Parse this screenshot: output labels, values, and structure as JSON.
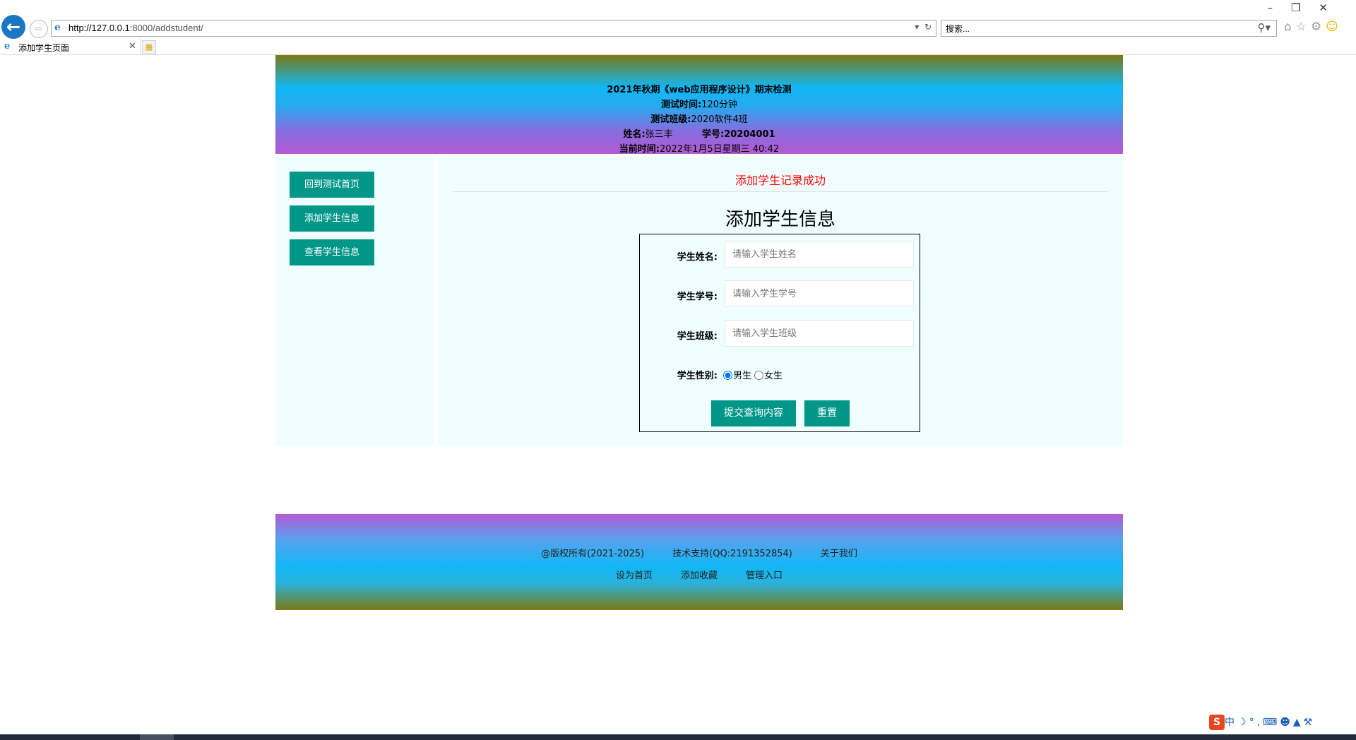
{
  "browser": {
    "url_host": "http://127.0.0.1",
    "url_rest": ":8000/addstudent/",
    "search_placeholder": "搜索...",
    "tab_title": "添加学生页面"
  },
  "header": {
    "title": "2021年秋期《web应用程序设计》期末检测",
    "time_label": "测试时间:",
    "time_value": "120分钟",
    "class_label": "测试班级:",
    "class_value": "2020软件4班",
    "name_label": "姓名:",
    "name_value": "张三丰",
    "id_label": "学号:",
    "id_value": "20204001",
    "now_label": "当前时间:",
    "now_value": "2022年1月5日星期三 40:42"
  },
  "sidebar": {
    "items": [
      {
        "label": "回到测试首页"
      },
      {
        "label": "添加学生信息"
      },
      {
        "label": "查看学生信息"
      }
    ]
  },
  "main": {
    "success_message": "添加学生记录成功",
    "form_title": "添加学生信息",
    "fields": {
      "name_label": "学生姓名:",
      "name_placeholder": "请输入学生姓名",
      "id_label": "学生学号:",
      "id_placeholder": "请输入学生学号",
      "class_label": "学生班级:",
      "class_placeholder": "请输入学生班级",
      "gender_label": "学生性别:",
      "gender_male": "男生",
      "gender_female": "女生",
      "gender_selected": "男生"
    },
    "submit_label": "提交查询内容",
    "reset_label": "重置"
  },
  "footer": {
    "copyright": "@版权所有(2021-2025)",
    "support": "技术支持(QQ:2191352854)",
    "about": "关于我们",
    "set_home": "设为首页",
    "add_favorite": "添加收藏",
    "admin": "管理入口"
  },
  "ime": {
    "label": "中"
  }
}
